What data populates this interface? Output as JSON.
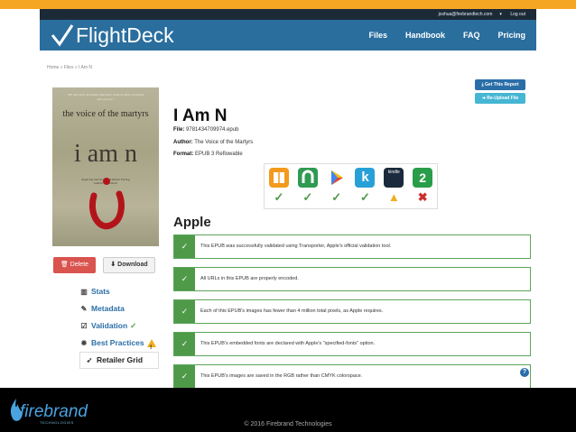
{
  "userbar": {
    "email": "joshua@firebrandtech.com",
    "logout": "Log out"
  },
  "app": {
    "name": "FlightDeck"
  },
  "nav": {
    "files": "Files",
    "handbook": "Handbook",
    "faq": "FAQ",
    "pricing": "Pricing"
  },
  "breadcrumb": "Home » Files » I Am N",
  "actions": {
    "get_report": "Get This Report",
    "reupload": "Re-Upload File"
  },
  "cover": {
    "blurb": "\"We will never be broken and never cease to shine, no matter how you try.\"",
    "title": "the voice of the martyrs",
    "big": "i am n",
    "subtitle": "Inspiring Stories of Christians Facing Islamic Extremists"
  },
  "book": {
    "title": "I Am N",
    "file_label": "File:",
    "file_value": "9781434709974.epub",
    "author_label": "Author:",
    "author_value": "The Voice of the Martyrs",
    "format_label": "Format:",
    "format_value": "EPUB 3 Reflowable"
  },
  "buttons": {
    "delete": "Delete",
    "download": "Download"
  },
  "sidenav": {
    "stats": "Stats",
    "metadata": "Metadata",
    "validation": "Validation",
    "best_practices": "Best Practices",
    "retailer_grid": "Retailer Grid"
  },
  "stores": [
    {
      "name": "ibooks",
      "color": "#f39a1c",
      "result": "pass"
    },
    {
      "name": "nook",
      "color": "#2f9a52",
      "result": "pass"
    },
    {
      "name": "google-play",
      "color": "#ffffff",
      "result": "pass"
    },
    {
      "name": "kobo",
      "color": "#27a0d7",
      "result": "pass"
    },
    {
      "name": "kindle",
      "color": "#1b2a3c",
      "result": "warn"
    },
    {
      "name": "scribd",
      "color": "#2a9d4a",
      "result": "fail"
    }
  ],
  "section_title": "Apple",
  "checks": [
    "This EPUB was successfully validated using Transporter, Apple's official validation tool.",
    "All URLs in this EPUB are properly encoded.",
    "Each of this EPUB's images has fewer than 4 million total pixels, as Apple requires.",
    "This EPUB's embedded fonts are declared with Apple's \"specified-fonts\" option.",
    "This EPUB's images are saved in the RGB rather than CMYK colorspace."
  ],
  "footer": {
    "brand": "firebrand",
    "brand_sub": "TECHNOLOGIES",
    "copyright": "© 2016 Firebrand Technologies"
  },
  "colors": {
    "nav": "#2a6e9e",
    "accent": "#f5a623",
    "pass": "#4f9a49",
    "warn": "#f0ad1e",
    "fail": "#c9302c"
  }
}
